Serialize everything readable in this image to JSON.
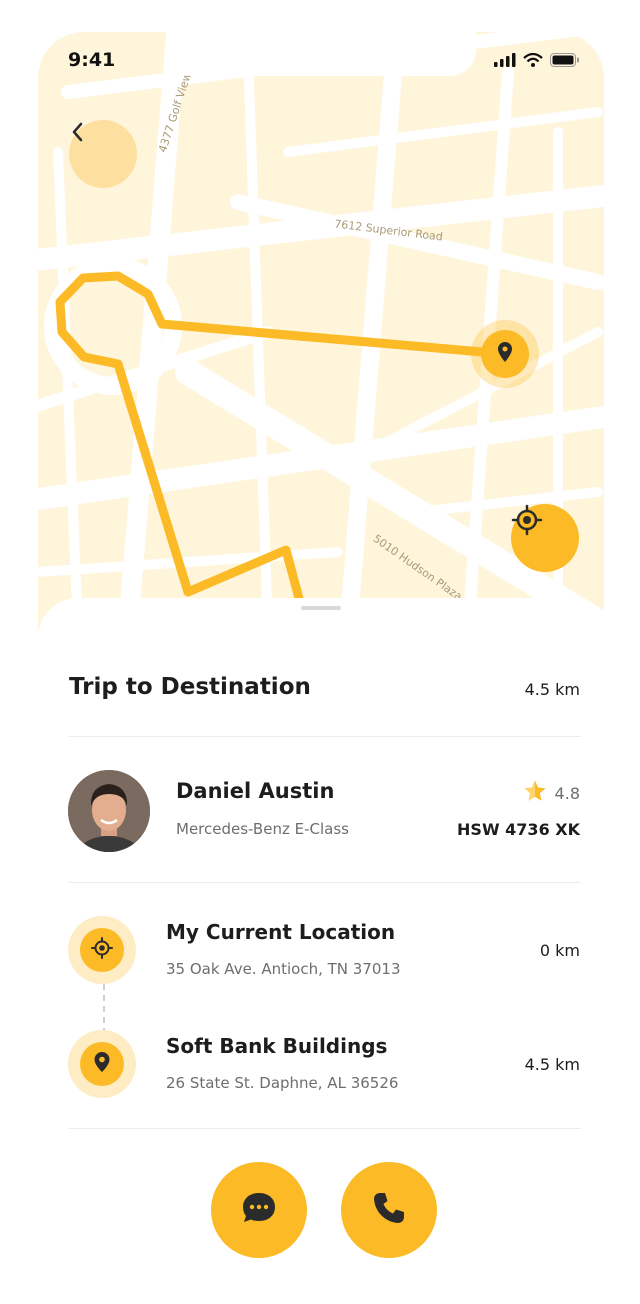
{
  "status_bar": {
    "time": "9:41"
  },
  "map": {
    "streets": [
      "4377 Golf View Trail",
      "7612 Superior Road",
      "5010 Hudson Plaza"
    ],
    "colors": {
      "background": "#fef5db",
      "road": "#ffffff",
      "route": "#fcbb26"
    }
  },
  "trip": {
    "title": "Trip to Destination",
    "distance": "4.5 km"
  },
  "driver": {
    "name": "Daniel Austin",
    "car": "Mercedes-Benz E-Class",
    "rating": "4.8",
    "plate": "HSW 4736 XK"
  },
  "locations": [
    {
      "title": "My Current Location",
      "address": "35 Oak Ave. Antioch, TN 37013",
      "distance": "0 km",
      "icon": "crosshair-icon"
    },
    {
      "title": "Soft Bank Buildings",
      "address": "26 State St. Daphne, AL 36526",
      "distance": "4.5 km",
      "icon": "map-pin-icon"
    }
  ],
  "actions": [
    {
      "icon": "chat-icon"
    },
    {
      "icon": "phone-icon"
    }
  ],
  "accent_color": "#fcbb26"
}
